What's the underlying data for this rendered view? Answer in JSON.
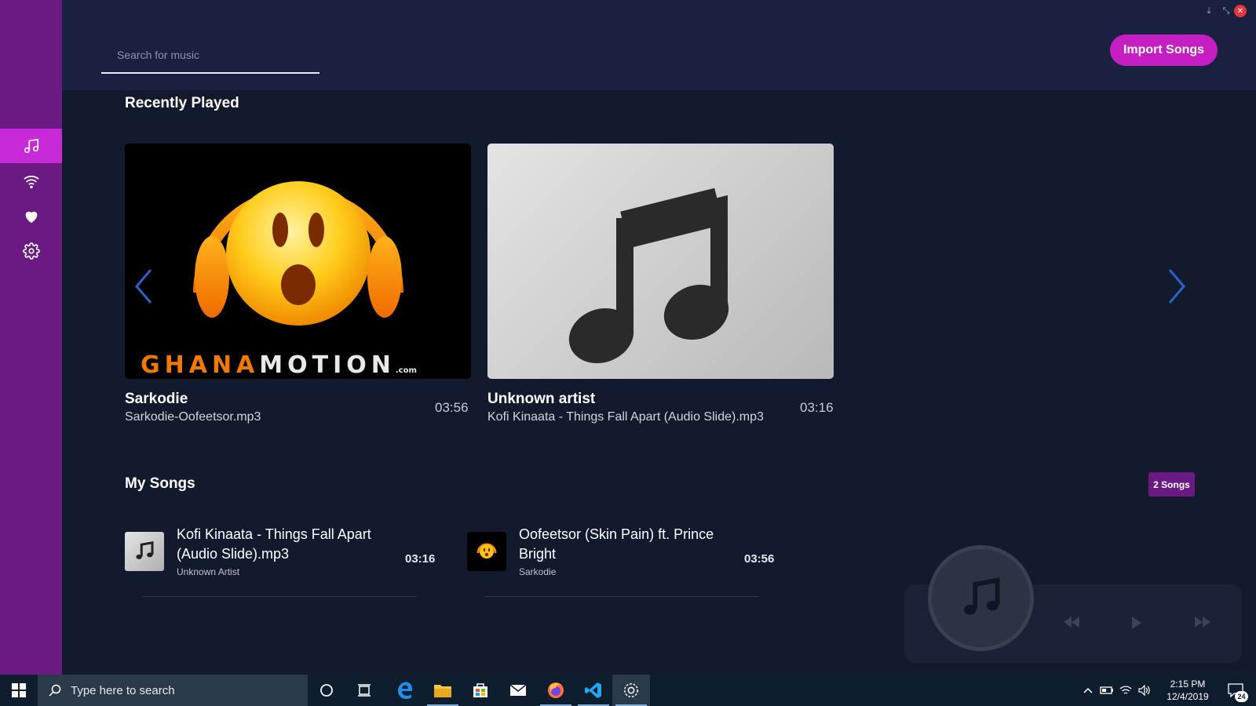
{
  "search": {
    "placeholder": "Search for music"
  },
  "import_button": "Import Songs",
  "sections": {
    "recent": "Recently Played",
    "my_songs": "My Songs"
  },
  "songs_count": "2 Songs",
  "recent_cards": [
    {
      "artist": "Sarkodie",
      "file": "Sarkodie-Oofeetsor.mp3",
      "duration": "03:56",
      "art_text": "GHANAMOTION",
      "art_sub": ".com"
    },
    {
      "artist": "Unknown artist",
      "file": "Kofi Kinaata - Things Fall Apart (Audio Slide).mp3",
      "duration": "03:16"
    }
  ],
  "my_songs": [
    {
      "title": "Kofi Kinaata - Things Fall Apart (Audio Slide).mp3",
      "artist": "Unknown Artist",
      "duration": "03:16"
    },
    {
      "title": "Oofeetsor (Skin Pain) ft. Prince Bright",
      "artist": "Sarkodie",
      "duration": "03:56"
    }
  ],
  "taskbar": {
    "search_text": "Type here to search",
    "time": "2:15 PM",
    "date": "12/4/2019",
    "notifications": "24"
  },
  "colors": {
    "sidebar": "#6a1a82",
    "accent": "#c51fc4",
    "background": "#141a2e",
    "topbar": "#1a2140"
  },
  "icons": {
    "sidebar": [
      "music-note-icon",
      "wifi-icon",
      "heart-icon",
      "gear-icon"
    ],
    "player": [
      "rewind-icon",
      "play-icon",
      "fast-forward-icon"
    ]
  }
}
